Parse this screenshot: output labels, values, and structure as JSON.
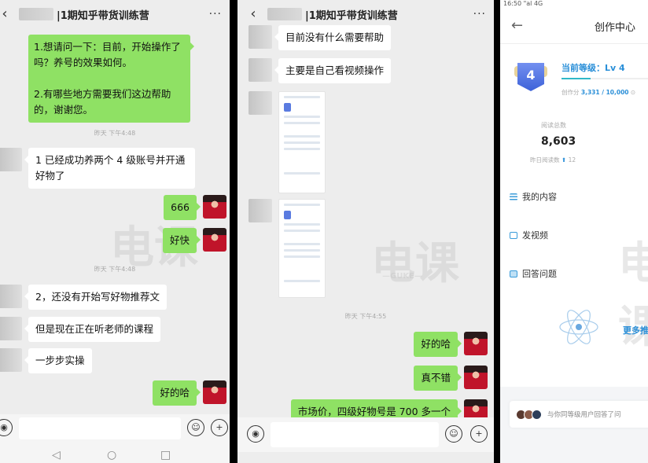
{
  "panel1": {
    "header": {
      "title": "|1期知乎带货训练营",
      "back_icon": "chevron-left",
      "more_icon": "more-dots"
    },
    "messages": [
      {
        "side": "out",
        "text": "1.想请问一下：目前，开始操作了吗？养号的效果如何。\n\n2.有哪些地方需要我们这边帮助的，谢谢您。"
      },
      {
        "type": "time",
        "text": "昨天 下午4:48"
      },
      {
        "side": "in",
        "text": "1 已经成功养两个 4 级账号并开通好物了"
      },
      {
        "side": "out",
        "text": "666"
      },
      {
        "side": "out",
        "text": "好快"
      },
      {
        "type": "time",
        "text": "昨天 下午4:48"
      },
      {
        "side": "in",
        "text": "2，还没有开始写好物推荐文"
      },
      {
        "side": "in",
        "text": "但是现在正在听老师的课程"
      },
      {
        "side": "in",
        "text": "一步步实操"
      },
      {
        "side": "out",
        "text": "好的哈"
      }
    ],
    "input": {
      "value": "",
      "voice_icon": "voice",
      "emoji_icon": "emoji",
      "plus_icon": "plus"
    },
    "nav": {
      "back": "◁",
      "home": "○",
      "recent": "□"
    }
  },
  "panel2": {
    "header": {
      "title": "|1期知乎带货训练营",
      "back_icon": "chevron-left",
      "more_icon": "more-dots"
    },
    "messages": [
      {
        "side": "in",
        "text": "目前没有什么需要帮助"
      },
      {
        "side": "in",
        "text": "主要是自己看视频操作"
      },
      {
        "side": "in",
        "type": "image",
        "text": "screenshot"
      },
      {
        "side": "in",
        "type": "image",
        "text": "screenshot"
      },
      {
        "type": "time",
        "text": "昨天 下午4:55"
      },
      {
        "side": "out",
        "text": "好的哈"
      },
      {
        "side": "out",
        "text": "真不错"
      },
      {
        "side": "out",
        "text": "市场价，四级好物号是 700 多一个"
      }
    ],
    "input": {
      "value": ""
    }
  },
  "panel3": {
    "status_bar": "16:50 \"al 4G",
    "header": {
      "title": "创作中心",
      "back_icon": "arrow-left"
    },
    "level": {
      "badge": "4",
      "label": "当前等级：Lv 4",
      "score_label": "创作分",
      "score": "3,331 / 10,000",
      "progress": 0.3331
    },
    "reads": {
      "label": "阅读总数",
      "total": "8,603",
      "yesterday_label": "昨日阅读数",
      "yesterday_delta": "12"
    },
    "menu": [
      {
        "label": "我的内容",
        "icon": "list-icon"
      },
      {
        "label": "发视频",
        "icon": "video-icon"
      },
      {
        "label": "回答问题",
        "icon": "answer-icon"
      }
    ],
    "more_text": "更多推",
    "peer_text": "与你同等级用户回答了问"
  },
  "watermark": {
    "brand": "电课",
    "sub": "—GUKE—"
  },
  "colors": {
    "bubble_out": "#8fe164",
    "bubble_in": "#ffffff",
    "chat_bg": "#ededed",
    "accent_blue": "#2a8fd8"
  }
}
